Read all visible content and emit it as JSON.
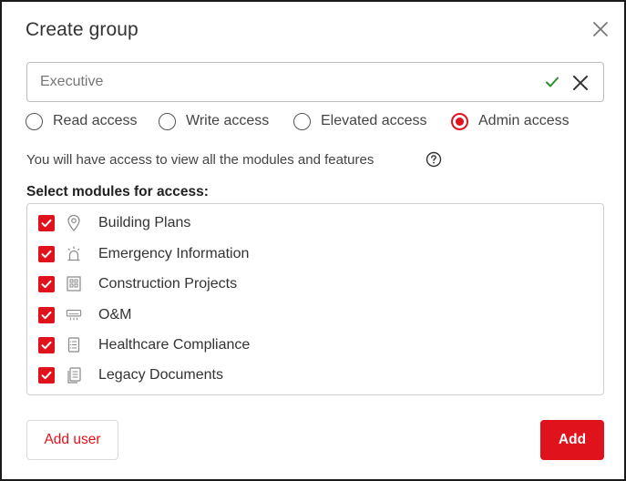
{
  "dialog": {
    "title": "Create group",
    "close_icon": "close-icon"
  },
  "group_name": {
    "value": "Executive",
    "confirm_icon": "checkmark-icon",
    "confirm_color": "#2e8b2e",
    "clear_icon": "clear-icon"
  },
  "access_levels": [
    {
      "label": "Read access",
      "selected": false
    },
    {
      "label": "Write access",
      "selected": false
    },
    {
      "label": "Elevated access",
      "selected": false
    },
    {
      "label": "Admin access",
      "selected": true
    }
  ],
  "access_description": "You will have access to view all the modules and features",
  "help_icon": "question-circle-icon",
  "modules_heading": "Select modules for access:",
  "modules": [
    {
      "label": "Building Plans",
      "icon": "location-pin-icon",
      "checked": true
    },
    {
      "label": "Emergency Information",
      "icon": "alarm-light-icon",
      "checked": true
    },
    {
      "label": "Construction Projects",
      "icon": "building-icon",
      "checked": true
    },
    {
      "label": "O&M",
      "icon": "air-conditioner-icon",
      "checked": true
    },
    {
      "label": "Healthcare Compliance",
      "icon": "clipboard-list-icon",
      "checked": true
    },
    {
      "label": "Legacy Documents",
      "icon": "documents-icon",
      "checked": true
    }
  ],
  "footer": {
    "add_user_label": "Add user",
    "add_label": "Add"
  },
  "colors": {
    "accent": "#e0121c",
    "border": "#bdbdbd",
    "text": "#333333"
  }
}
